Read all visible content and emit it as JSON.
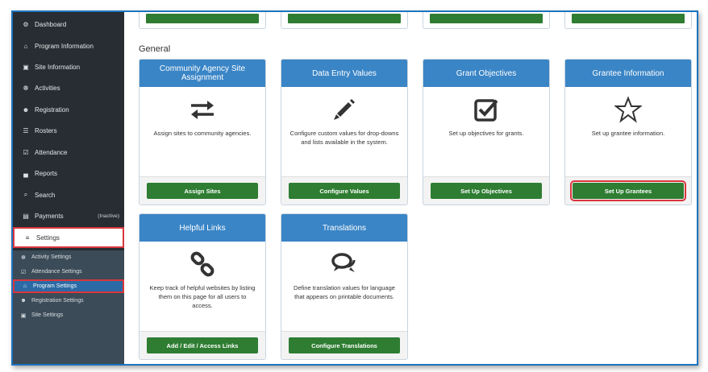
{
  "sidebar": {
    "items": [
      {
        "label": "Dashboard",
        "icon": "dashboard-icon",
        "glyph": "⚙"
      },
      {
        "label": "Program Information",
        "icon": "bank-icon",
        "glyph": "⌂"
      },
      {
        "label": "Site Information",
        "icon": "building-icon",
        "glyph": "▣"
      },
      {
        "label": "Activities",
        "icon": "activities-icon",
        "glyph": "☸"
      },
      {
        "label": "Registration",
        "icon": "users-icon",
        "glyph": "☻"
      },
      {
        "label": "Rosters",
        "icon": "list-icon",
        "glyph": "☰"
      },
      {
        "label": "Attendance",
        "icon": "calendar-check-icon",
        "glyph": "☑"
      },
      {
        "label": "Reports",
        "icon": "chart-icon",
        "glyph": "▄"
      },
      {
        "label": "Search",
        "icon": "search-icon",
        "glyph": "⌕"
      },
      {
        "label": "Payments",
        "icon": "money-icon",
        "glyph": "▤",
        "status": "(Inactive)"
      },
      {
        "label": "Settings",
        "icon": "sliders-icon",
        "glyph": "≡"
      }
    ],
    "settings_sub": [
      {
        "label": "Activity Settings",
        "icon": "activities-icon",
        "glyph": "☸"
      },
      {
        "label": "Attendance Settings",
        "icon": "calendar-check-icon",
        "glyph": "☑"
      },
      {
        "label": "Program Settings",
        "icon": "bank-icon",
        "glyph": "⌂"
      },
      {
        "label": "Registration Settings",
        "icon": "users-icon",
        "glyph": "☻"
      },
      {
        "label": "Site Settings",
        "icon": "building-icon",
        "glyph": "▣"
      }
    ]
  },
  "main": {
    "section_title": "General",
    "cards": [
      {
        "title": "Community Agency Site Assignment",
        "icon": "exchange-arrows-icon",
        "description": "Assign sites to community agencies.",
        "button": "Assign Sites"
      },
      {
        "title": "Data Entry Values",
        "icon": "pencil-icon",
        "description": "Configure custom values for drop-downs and lists available in the system.",
        "button": "Configure Values"
      },
      {
        "title": "Grant Objectives",
        "icon": "checkbox-checked-icon",
        "description": "Set up objectives for grants.",
        "button": "Set Up Objectives"
      },
      {
        "title": "Grantee Information",
        "icon": "star-outline-icon",
        "description": "Set up grantee information.",
        "button": "Set Up Grantees"
      },
      {
        "title": "Helpful Links",
        "icon": "chain-link-icon",
        "description": "Keep track of helpful websites by listing them on this page for all users to access.",
        "button": "Add / Edit / Access Links"
      },
      {
        "title": "Translations",
        "icon": "speech-bubbles-icon",
        "description": "Define translation values for language that appears on printable documents.",
        "button": "Configure Translations"
      }
    ]
  },
  "colors": {
    "sidebar": "#272d33",
    "subnav": "#3b4b57",
    "card_header": "#3a85c6",
    "button": "#2e7d32",
    "highlight": "#d9363e",
    "frame": "#1e73be"
  }
}
